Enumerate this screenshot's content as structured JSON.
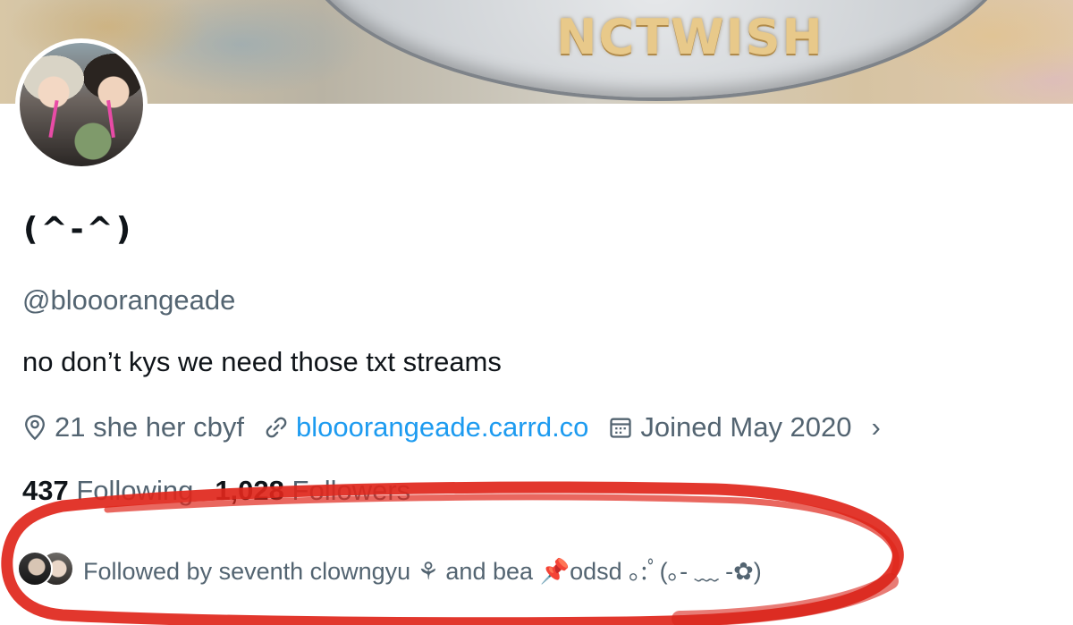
{
  "banner": {
    "text": "NCTWISH"
  },
  "profile": {
    "display_name": "(^-^)",
    "handle": "@blooorangeade",
    "bio": "no don’t kys we need those txt streams",
    "location": "21 she her cbyf",
    "link": "blooorangeade.carrd.co",
    "joined": "Joined May 2020",
    "more_chevron": "›"
  },
  "stats": {
    "following_count": "437",
    "following_label": "Following",
    "followers_count": "1,028",
    "followers_label": "Followers"
  },
  "followed_by": {
    "text": "Followed by seventh clowngyu ⚘ and bea 📌odsd ｡:ﾟ(｡- ﹏ -✿)"
  },
  "icons": {
    "location": "location-pin-icon",
    "link": "link-icon",
    "calendar": "calendar-icon"
  },
  "colors": {
    "link": "#1d9bf0",
    "secondary_text": "#536471",
    "primary_text": "#0f1419",
    "annotation": "#e0261b"
  }
}
